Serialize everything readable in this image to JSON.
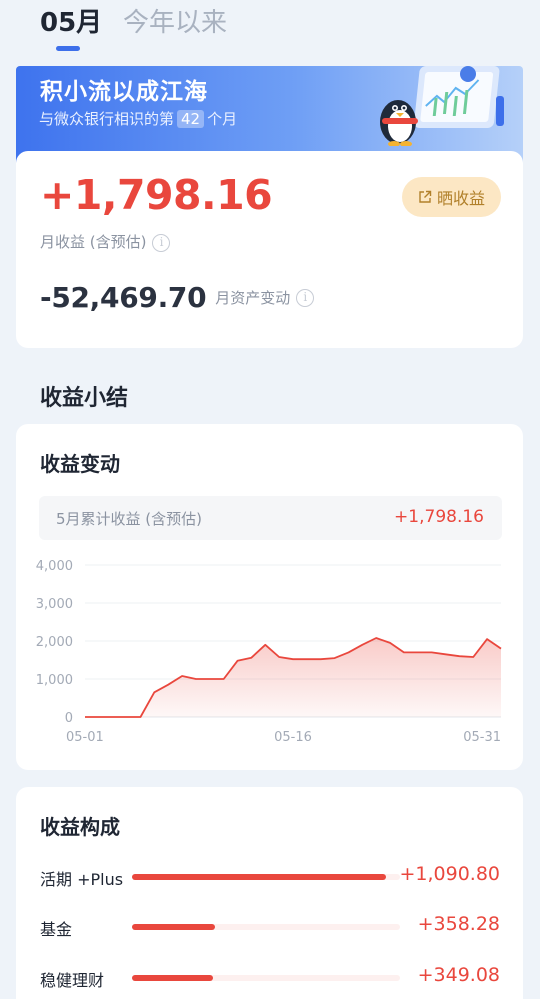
{
  "tabs": {
    "active": "05月",
    "inactive": "今年以来"
  },
  "banner": {
    "title": "积小流以成江海",
    "sub_prefix": "与微众银行相识的第",
    "months": "42",
    "sub_suffix": "个月"
  },
  "summary": {
    "monthly_income": "+1,798.16",
    "monthly_income_label": "月收益 (含预估)",
    "share_label": "晒收益",
    "asset_change": "-52,469.70",
    "asset_change_label": "月资产变动"
  },
  "section_title": "收益小结",
  "income_change": {
    "title": "收益变动",
    "cumulative_label": "5月累计收益 (含预估)",
    "cumulative_value": "+1,798.16"
  },
  "chart_data": {
    "type": "area",
    "title": "",
    "xlabel": "",
    "ylabel": "",
    "ylim": [
      0,
      4000
    ],
    "y_ticks": [
      "4,000",
      "3,000",
      "2,000",
      "1,000",
      "0"
    ],
    "y_tick_values": [
      4000,
      3000,
      2000,
      1000,
      0
    ],
    "x_ticks": [
      "05-01",
      "05-16",
      "05-31"
    ],
    "x_tick_days": [
      1,
      16,
      31
    ],
    "grid": true,
    "color": "#e9473d",
    "series": [
      {
        "x": [
          1,
          2,
          3,
          4,
          5,
          6,
          7,
          8,
          9,
          10,
          11,
          12,
          13,
          14,
          15,
          16,
          17,
          18,
          19,
          20,
          21,
          22,
          23,
          24,
          25,
          26,
          27,
          28,
          29,
          30,
          31
        ],
        "values": [
          0,
          0,
          0,
          0,
          0,
          650,
          850,
          1080,
          1000,
          1000,
          1000,
          1480,
          1560,
          1900,
          1580,
          1520,
          1520,
          1520,
          1550,
          1700,
          1900,
          2080,
          1950,
          1700,
          1700,
          1700,
          1650,
          1600,
          1580,
          2050,
          1800
        ]
      }
    ]
  },
  "composition": {
    "title": "收益构成",
    "items": [
      {
        "name": "活期 +Plus",
        "value": "+1,090.80",
        "share": 0.6066
      },
      {
        "name": "基金",
        "value": "+358.28",
        "share": 0.1992
      },
      {
        "name": "稳健理财",
        "value": "+349.08",
        "share": 0.1941
      }
    ]
  },
  "colors": {
    "accent": "#3d6fea",
    "income": "#e9473d",
    "share_bg": "#fce7c4",
    "share_text": "#b1802a"
  }
}
